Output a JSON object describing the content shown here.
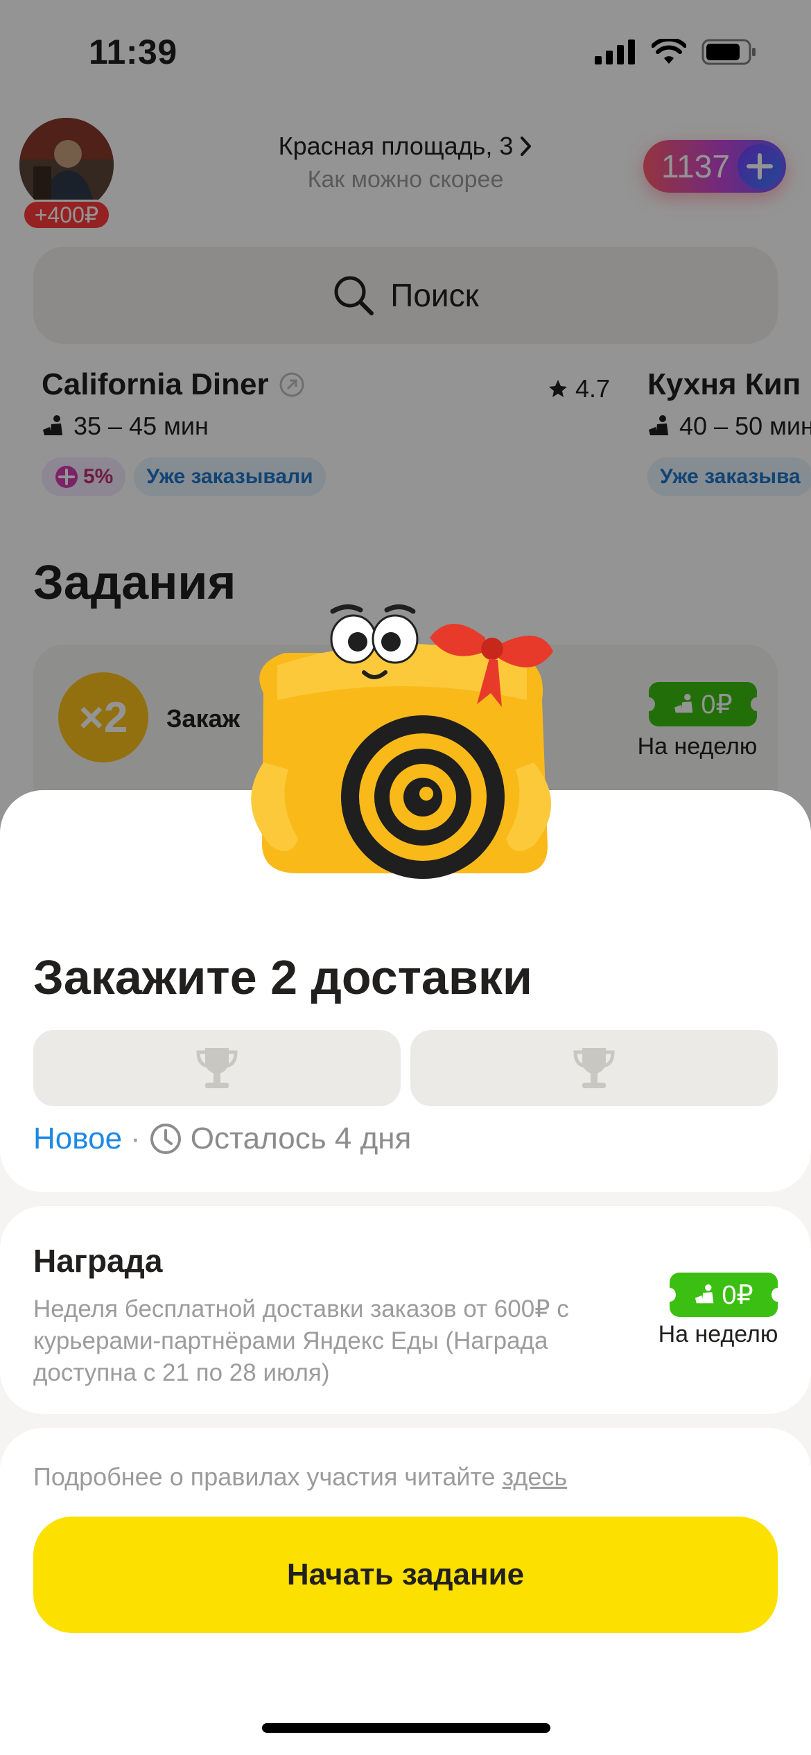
{
  "status_bar": {
    "time": "11:39"
  },
  "header": {
    "avatar_badge": "+400₽",
    "address": "Красная площадь, 3",
    "delivery_time": "Как можно скорее",
    "plus_points": "1137"
  },
  "search": {
    "label": "Поиск"
  },
  "restaurants": [
    {
      "name": "California Diner",
      "rating": "4.7",
      "time": "35 – 45 мин",
      "plus_tag": "5%",
      "ordered_tag": "Уже заказывали"
    },
    {
      "name": "Кухня Кип",
      "time": "40 – 50 мин",
      "ordered_tag": "Уже заказыва"
    }
  ],
  "tasks_section": {
    "title": "Задания",
    "card_label": "Закаж",
    "multiplier": "×2",
    "badge_value": "0₽",
    "badge_caption": "На неделю"
  },
  "sheet": {
    "title": "Закажите 2 доставки",
    "status_new": "Новое",
    "separator": "·",
    "time_left": "Осталось 4 дня",
    "reward": {
      "title": "Награда",
      "description": "Неделя бесплатной доставки заказов от 600₽ с курьерами-партнёрами Яндекс Еды (Награда доступна с 21 по 28 июля)",
      "badge_value": "0₽",
      "badge_caption": "На неделю"
    },
    "rules_text": "Подробнее о правилах участия читайте",
    "rules_link": "здесь",
    "start_button": "Начать задание"
  },
  "colors": {
    "accent_yellow": "#fce000",
    "link_blue": "#1e88e5",
    "badge_green": "#3bbf12",
    "plus_gradient_start": "#ff5c6c",
    "plus_gradient_end": "#6a5cff"
  },
  "icons": [
    "signal-icon",
    "wifi-icon",
    "battery-icon",
    "chevron-right-icon",
    "plus-icon",
    "search-icon",
    "star-icon",
    "courier-icon",
    "trophy-icon",
    "clock-icon"
  ]
}
